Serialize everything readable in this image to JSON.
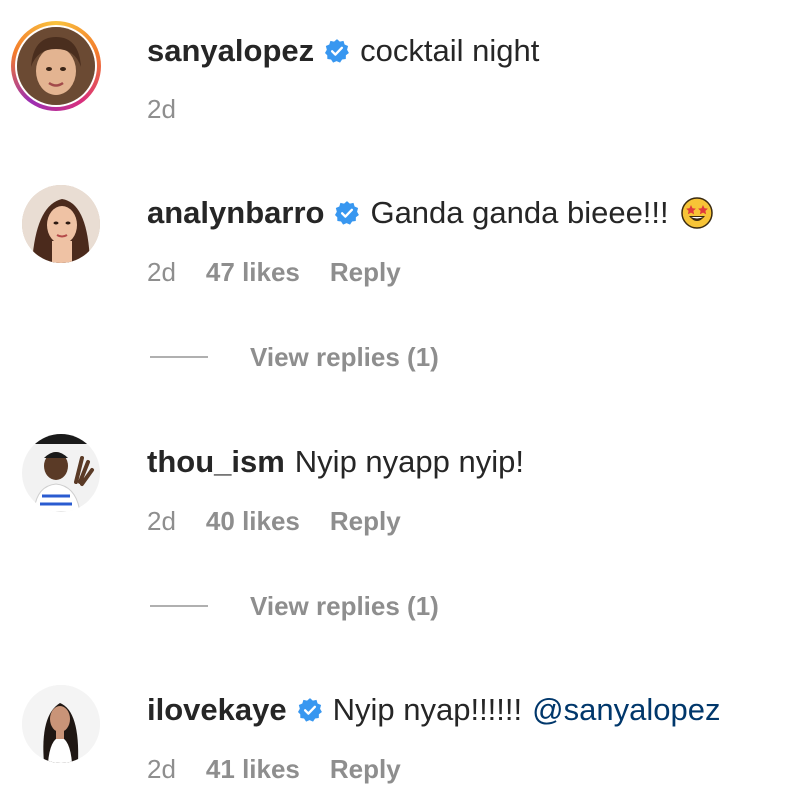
{
  "caption": {
    "username": "sanyalopez",
    "text": "cocktail night",
    "time": "2d"
  },
  "comments": [
    {
      "username": "analynbarro",
      "verified": true,
      "text": "Ganda ganda bieee!!!",
      "emoji": "star-struck-emoji",
      "time": "2d",
      "likes": "47 likes",
      "reply_label": "Reply",
      "view_replies": "View replies (1)"
    },
    {
      "username": "thou_ism",
      "verified": false,
      "text": "Nyip nyapp nyip!",
      "time": "2d",
      "likes": "40 likes",
      "reply_label": "Reply",
      "view_replies": "View replies (1)"
    },
    {
      "username": "ilovekaye",
      "verified": true,
      "text": "Nyip nyap!!!!!!",
      "mention": "@sanyalopez",
      "time": "2d",
      "likes": "41 likes",
      "reply_label": "Reply"
    }
  ],
  "colors": {
    "verified_badge": "#3897f0",
    "mention": "#00376b",
    "muted": "#8e8e8e"
  }
}
